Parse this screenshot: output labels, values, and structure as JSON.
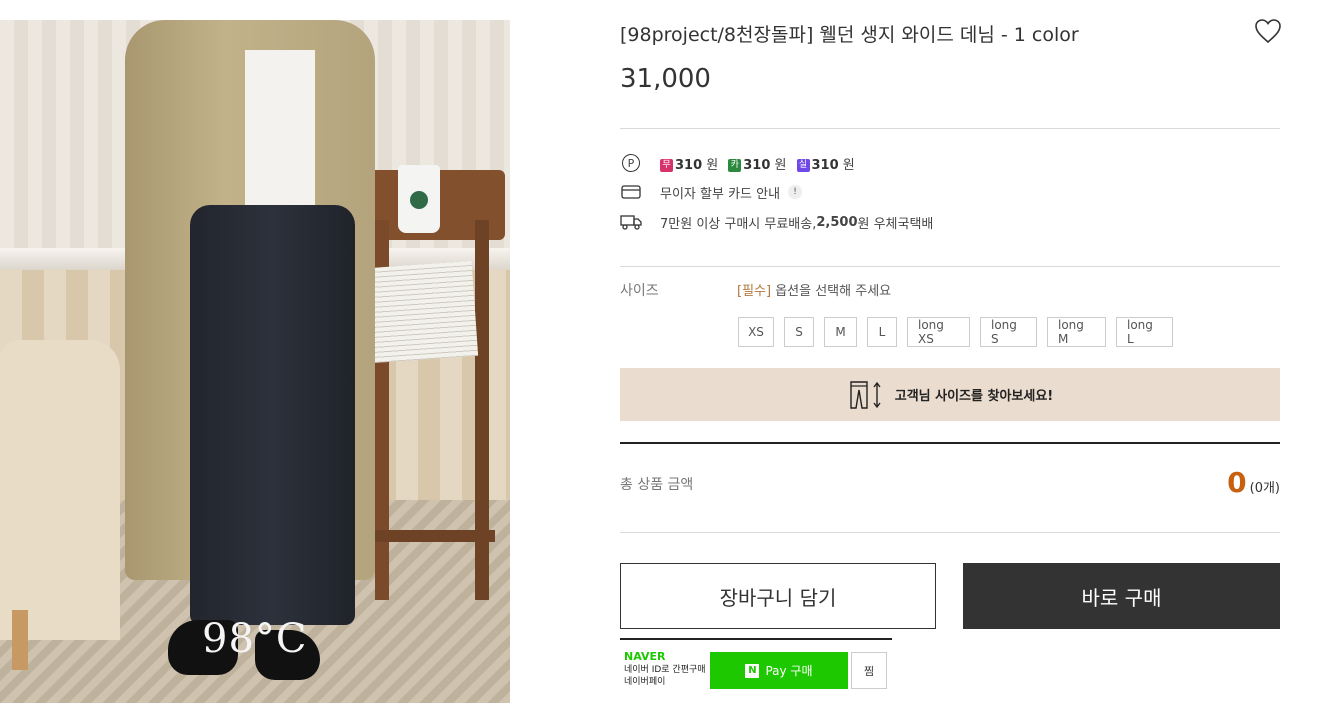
{
  "product": {
    "title": "[98project/8천장돌파] 웰던 생지 와이드 데님 - 1 color",
    "price": "31,000",
    "image_logo": "98°C"
  },
  "points": {
    "items": [
      {
        "badge": "무",
        "badge_color": "#d6336c",
        "amount": "310",
        "unit": "원"
      },
      {
        "badge": "카",
        "badge_color": "#2b8a3e",
        "amount": "310",
        "unit": "원"
      },
      {
        "badge": "실",
        "badge_color": "#7048e8",
        "amount": "310",
        "unit": "원"
      }
    ],
    "card_notice": "무이자 할부 카드 안내",
    "shipping_prefix": "7만원 이상 구매시 무료배송, ",
    "shipping_fee": "2,500",
    "shipping_suffix": "원 우체국택배"
  },
  "option": {
    "label": "사이즈",
    "required_tag": "[필수]",
    "hint": " 옵션을 선택해 주세요",
    "sizes": [
      "XS",
      "S",
      "M",
      "L",
      "long XS",
      "long S",
      "long M",
      "long L"
    ]
  },
  "size_finder": {
    "label": "고객님 사이즈를 찾아보세요!"
  },
  "total": {
    "label": "총 상품 금액",
    "value": "0",
    "count": "(0개)"
  },
  "buttons": {
    "cart": "장바구니 담기",
    "buy": "바로 구매"
  },
  "naver": {
    "brand": "NAVER",
    "sub1": "네이버 ID로 간편구매",
    "sub2": "네이버페이",
    "pay_label": "Pay 구매",
    "zzim": "찜"
  },
  "colors": {
    "accent": "#c7600f",
    "finder_bg": "#eadccf",
    "buy_bg": "#333333",
    "naver_green": "#1ec800"
  },
  "icons": [
    "heart-icon",
    "point-icon",
    "card-icon",
    "truck-icon",
    "info-icon",
    "pants-ruler-icon",
    "naver-n-icon"
  ]
}
